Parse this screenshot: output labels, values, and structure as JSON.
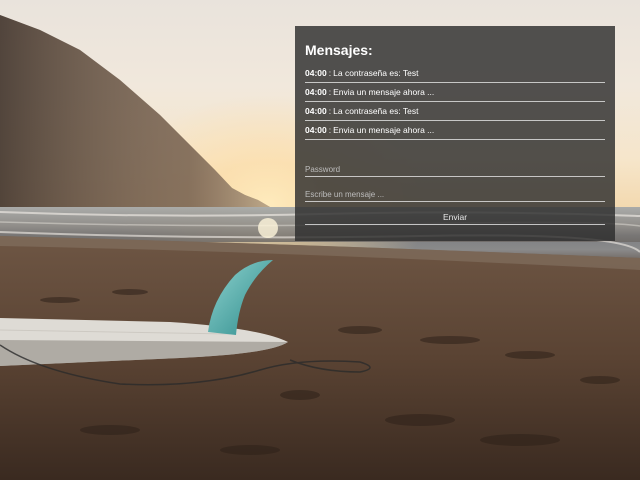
{
  "chat": {
    "title": "Mensajes:",
    "messages": [
      {
        "time": "04:00",
        "separator": ":",
        "text": "La contraseña es: Test"
      },
      {
        "time": "04:00",
        "separator": ":",
        "text": "Envia un mensaje ahora ..."
      },
      {
        "time": "04:00",
        "separator": ":",
        "text": "La contraseña es: Test"
      },
      {
        "time": "04:00",
        "separator": ":",
        "text": "Envia un mensaje ahora ..."
      }
    ],
    "password_placeholder": "Password",
    "message_placeholder": "Escribe un mensaje ...",
    "send_label": "Enviar"
  },
  "colors": {
    "panel_bg": "#2d2d2d",
    "text": "#ffffff"
  }
}
